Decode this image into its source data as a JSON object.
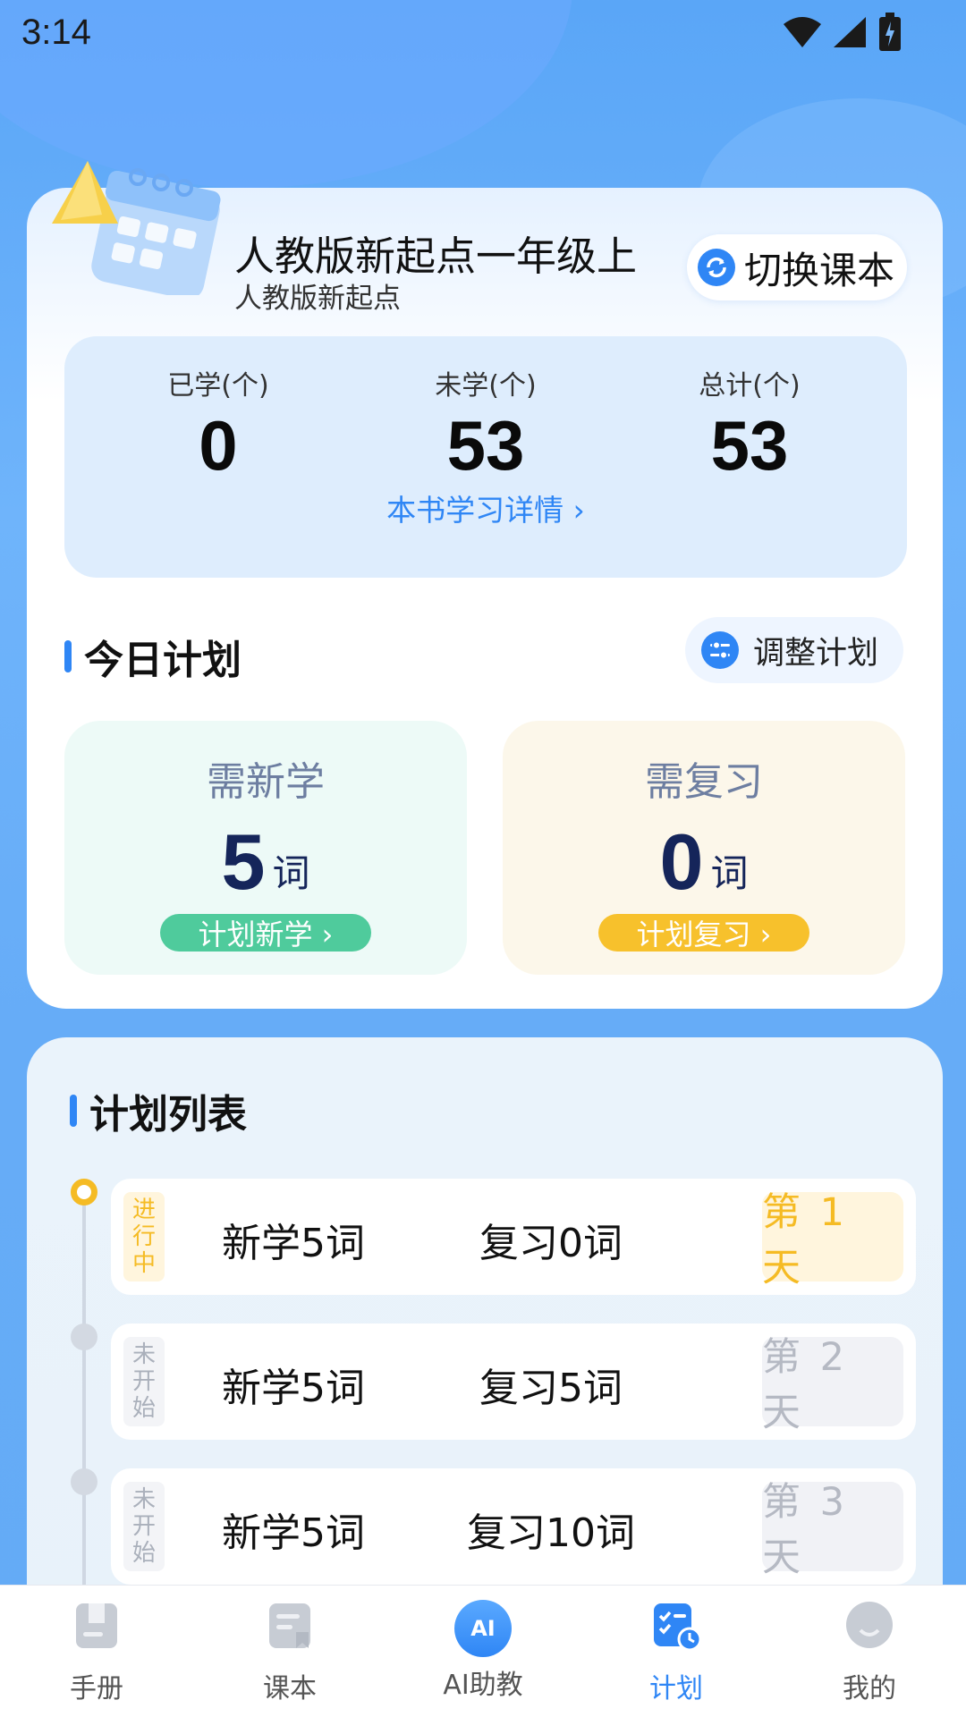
{
  "status_bar": {
    "time": "3:14"
  },
  "book": {
    "title": "人教版新起点一年级上",
    "subtitle": "人教版新起点",
    "switch_label": "切换课本"
  },
  "stats": [
    {
      "label": "已学(个)",
      "value": "0"
    },
    {
      "label": "未学(个)",
      "value": "53"
    },
    {
      "label": "总计(个)",
      "value": "53"
    }
  ],
  "detail_link": "本书学习详情 ›",
  "today": {
    "title": "今日计划",
    "adjust_label": "调整计划",
    "new": {
      "title": "需新学",
      "value": "5",
      "unit": "词",
      "action": "计划新学 ›"
    },
    "review": {
      "title": "需复习",
      "value": "0",
      "unit": "词",
      "action": "计划复习 ›"
    }
  },
  "plan_list": {
    "title": "计划列表",
    "rows": [
      {
        "status": "进行中",
        "new": "新学5词",
        "review": "复习0词",
        "day": "第 1 天"
      },
      {
        "status": "未开始",
        "new": "新学5词",
        "review": "复习5词",
        "day": "第 2 天"
      },
      {
        "status": "未开始",
        "new": "新学5词",
        "review": "复习10词",
        "day": "第 3 天"
      }
    ]
  },
  "nav": {
    "items": [
      {
        "label": "手册"
      },
      {
        "label": "课本"
      },
      {
        "label": "AI助教"
      },
      {
        "label": "计划"
      },
      {
        "label": "我的"
      }
    ],
    "ai_badge": "AI"
  },
  "colors": {
    "accent": "#2f86f5",
    "new_tile_bg": "#edfaf7",
    "new_pill": "#4fcb9c",
    "review_tile_bg": "#fcf7ea",
    "review_pill": "#f7c12c",
    "in_progress": "#f5bb24"
  }
}
